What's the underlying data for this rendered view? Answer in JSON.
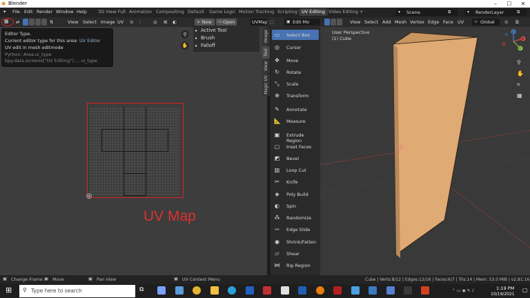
{
  "window": {
    "title": "Blender"
  },
  "menu": [
    "File",
    "Edit",
    "Render",
    "Window",
    "Help"
  ],
  "workspaces": [
    "3D View Full",
    "Animation",
    "Compositing",
    "Default",
    "Game Logic",
    "Motion Tracking",
    "Scripting",
    "UV Editing",
    "Video Editing"
  ],
  "active_workspace": "UV Editing",
  "scene": "Scene",
  "render_layer": "RenderLayer",
  "uv_editor": {
    "menus": [
      "View",
      "Select",
      "Image",
      "UV"
    ],
    "new_label": "+ New",
    "open_label": "Open",
    "uvmap_label": "UVMap",
    "panel_items": [
      "Active Tool",
      "Brush",
      "Falloff"
    ],
    "side_tabs": [
      "Image",
      "Tool",
      "View",
      "Magic UV"
    ]
  },
  "tooltip": {
    "title": "Editor Type.",
    "desc_prefix": "Current editor type for this area:",
    "desc_value": "UV Editor",
    "line2": "UV edit in mesh editmode",
    "py1": "Python: Area.ui_type",
    "py2": "bpy.data.screens[\"UV Editing\"] ... ui_type"
  },
  "annotation": {
    "uv_map_label": "UV Map"
  },
  "viewport": {
    "mode": "Edit Mo",
    "menus": [
      "View",
      "Select",
      "Add",
      "Mesh",
      "Vertex",
      "Edge",
      "Face",
      "UV"
    ],
    "transform": "Global",
    "perspective": "User Perspective",
    "object": "(1) Cube",
    "axis": {
      "x": "X",
      "y": "Y",
      "z": "Z"
    }
  },
  "tools": [
    {
      "name": "Select Box",
      "icon": "select-box-icon",
      "glyph": "▭",
      "selected": true
    },
    {
      "name": "Cursor",
      "icon": "cursor-icon",
      "glyph": "◎",
      "selected": false
    },
    {
      "name": "Move",
      "icon": "move-icon",
      "glyph": "✥",
      "selected": false
    },
    {
      "name": "Rotate",
      "icon": "rotate-icon",
      "glyph": "↻",
      "selected": false
    },
    {
      "name": "Scale",
      "icon": "scale-icon",
      "glyph": "⤡",
      "selected": false
    },
    {
      "name": "Transform",
      "icon": "transform-icon",
      "glyph": "⊕",
      "selected": false
    },
    {
      "name": "Annotate",
      "icon": "annotate-icon",
      "glyph": "✎",
      "selected": false
    },
    {
      "name": "Measure",
      "icon": "measure-icon",
      "glyph": "📐",
      "selected": false
    },
    {
      "name": "Extrude Region",
      "icon": "extrude-icon",
      "glyph": "▣",
      "selected": false
    },
    {
      "name": "Inset Faces",
      "icon": "inset-icon",
      "glyph": "▢",
      "selected": false
    },
    {
      "name": "Bevel",
      "icon": "bevel-icon",
      "glyph": "◩",
      "selected": false
    },
    {
      "name": "Loop Cut",
      "icon": "loop-cut-icon",
      "glyph": "▥",
      "selected": false
    },
    {
      "name": "Knife",
      "icon": "knife-icon",
      "glyph": "✂",
      "selected": false
    },
    {
      "name": "Poly Build",
      "icon": "poly-build-icon",
      "glyph": "◈",
      "selected": false
    },
    {
      "name": "Spin",
      "icon": "spin-icon",
      "glyph": "◐",
      "selected": false
    },
    {
      "name": "Randomize",
      "icon": "randomize-icon",
      "glyph": "⁂",
      "selected": false
    },
    {
      "name": "Edge Slide",
      "icon": "edge-slide-icon",
      "glyph": "⇿",
      "selected": false
    },
    {
      "name": "Shrink/Fatten",
      "icon": "shrink-fatten-icon",
      "glyph": "◉",
      "selected": false
    },
    {
      "name": "Shear",
      "icon": "shear-icon",
      "glyph": "▱",
      "selected": false
    },
    {
      "name": "Rip Region",
      "icon": "rip-icon",
      "glyph": "⋈",
      "selected": false
    }
  ],
  "status": {
    "change_frame": "Change Frame",
    "move": "Move",
    "pan_view": "Pan View",
    "context_menu": "UV Context Menu",
    "stats": "Cube | Verts:8/12 | Edges:12/16 | Faces:6/7 | Tris:14 | Mem: 53.0 MiB | v2.81.16"
  },
  "taskbar": {
    "search_placeholder": "Type here to search",
    "time": "1:19 PM",
    "date": "10/19/2021"
  },
  "colors": {
    "accent": "#4772b3",
    "annotation": "#e03030",
    "object": "#e0aa74"
  }
}
